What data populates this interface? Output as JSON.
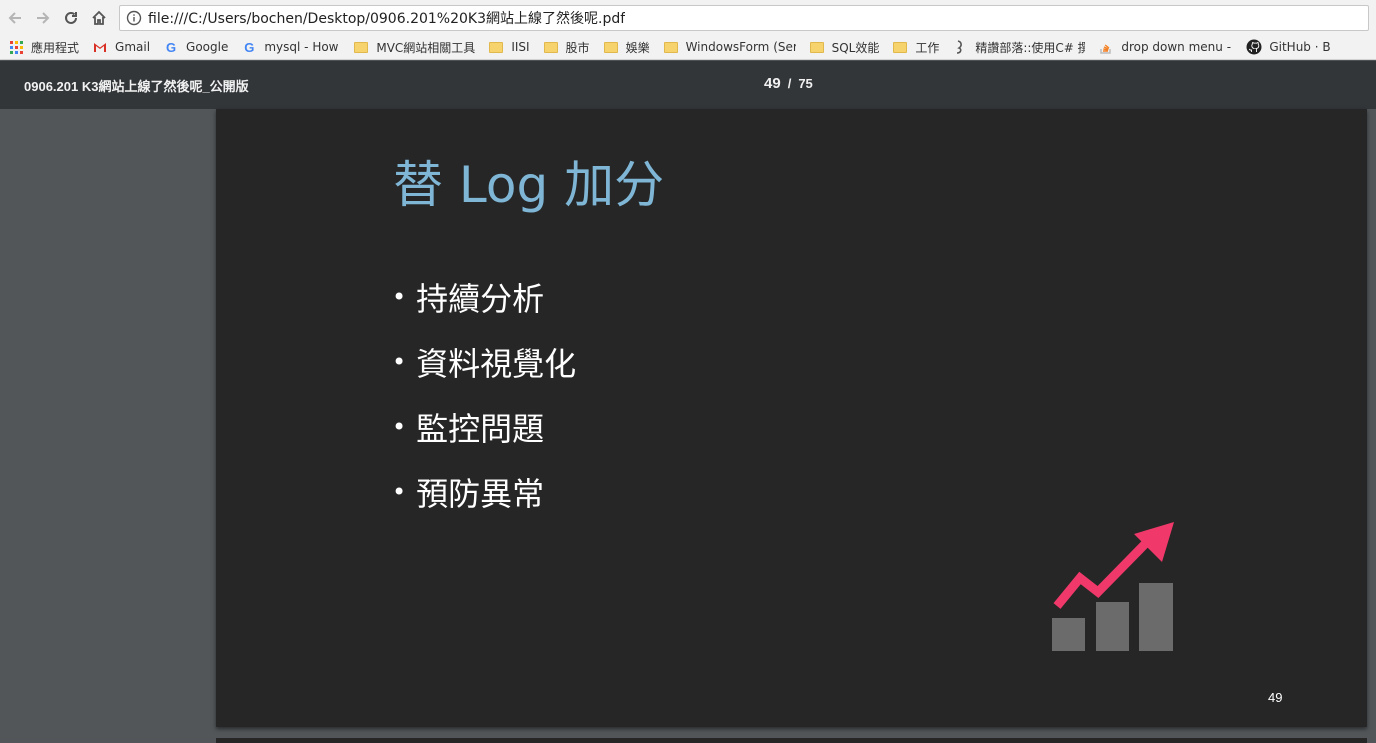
{
  "browser": {
    "url": "file:///C:/Users/bochen/Desktop/0906.201%20K3網站上線了然後呢.pdf"
  },
  "bookmarks": [
    {
      "label": "應用程式",
      "icon": "apps-grid-icon"
    },
    {
      "label": "Gmail",
      "icon": "gmail-icon"
    },
    {
      "label": "Google",
      "icon": "google-icon"
    },
    {
      "label": "mysql - How can I m",
      "icon": "google-icon"
    },
    {
      "label": "MVC網站相關工具",
      "icon": "folder-icon"
    },
    {
      "label": "IISI",
      "icon": "folder-icon"
    },
    {
      "label": "股市",
      "icon": "folder-icon"
    },
    {
      "label": "娛樂",
      "icon": "folder-icon"
    },
    {
      "label": "WindowsForm (Serv",
      "icon": "folder-icon"
    },
    {
      "label": "SQL效能",
      "icon": "folder-icon"
    },
    {
      "label": "工作",
      "icon": "folder-icon"
    },
    {
      "label": "精讚部落::使用C# 撰",
      "icon": "blog-icon"
    },
    {
      "label": "drop down menu - (",
      "icon": "stackoverflow-icon"
    },
    {
      "label": "GitHub · B",
      "icon": "github-icon"
    }
  ],
  "pdf": {
    "title": "0906.201 K3網站上線了然後呢_公開版",
    "current_page": "49",
    "separator": "/",
    "total_pages": "75"
  },
  "slide": {
    "title": "替 Log 加分",
    "bullets": [
      "持續分析",
      "資料視覺化",
      "監控問題",
      "預防異常"
    ],
    "page_number": "49",
    "illustration": "growth-chart-icon",
    "colors": {
      "background": "#262626",
      "title": "#7fb6d5",
      "text": "#ffffff",
      "arrow": "#f0396a",
      "bars": "#6b6b6b"
    }
  }
}
